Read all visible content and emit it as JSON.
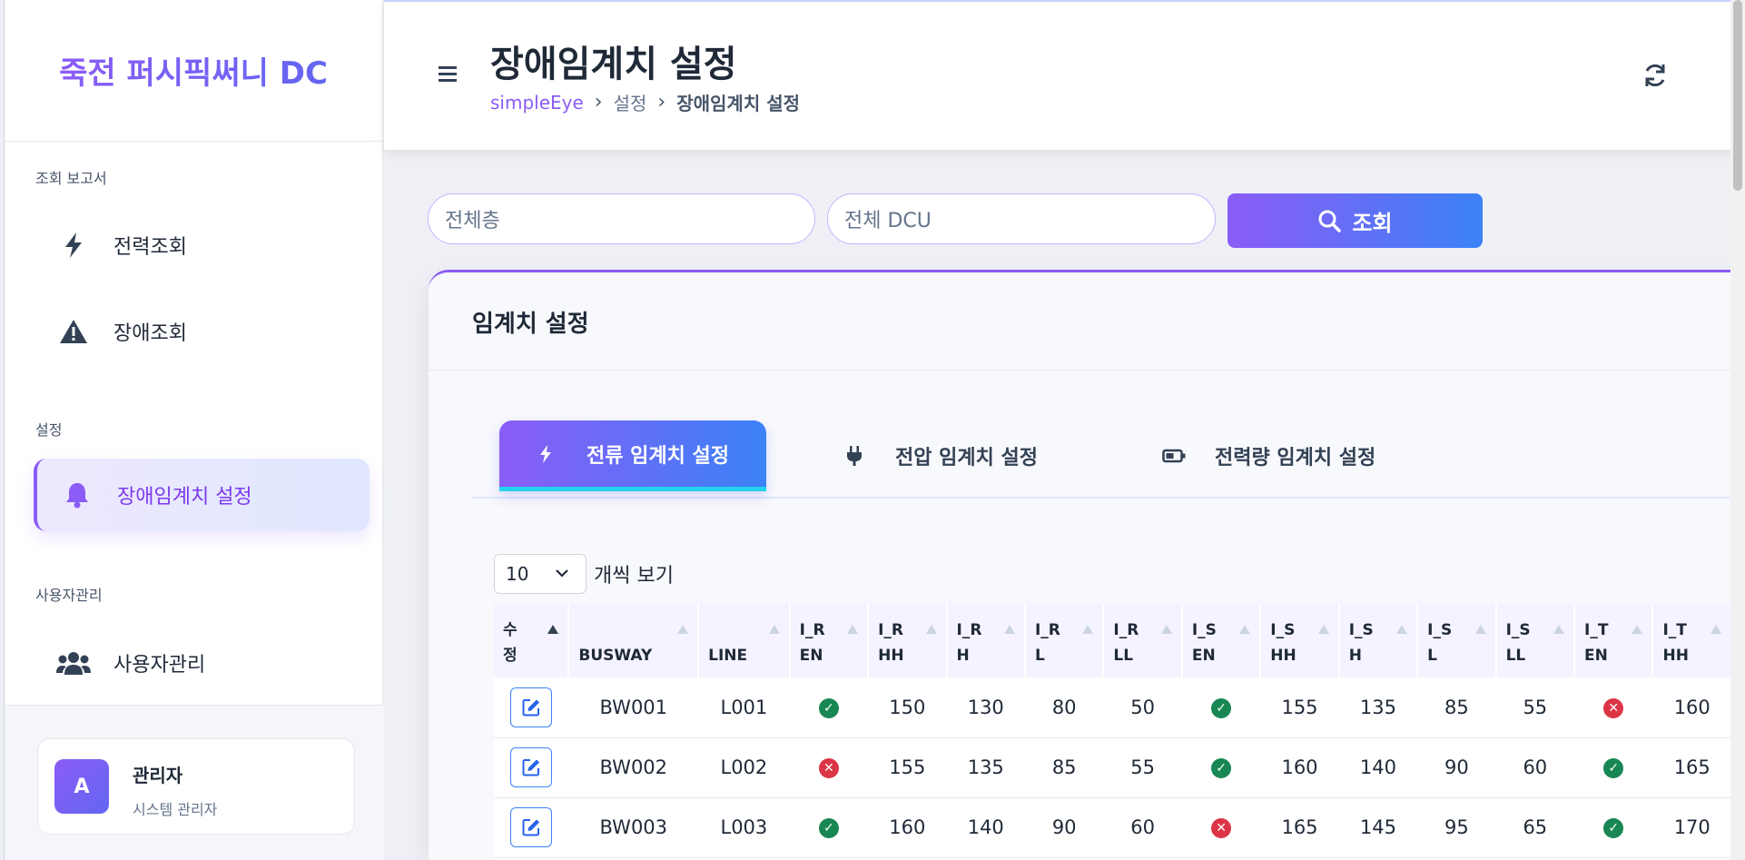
{
  "sidebar": {
    "brand": "죽전 퍼시픽써니 DC",
    "sections": [
      {
        "label": "조회 보고서"
      },
      {
        "label": "설정"
      },
      {
        "label": "사용자관리"
      }
    ],
    "items": [
      {
        "label": "전력조회",
        "icon": "bolt-icon"
      },
      {
        "label": "장애조회",
        "icon": "warning-icon"
      },
      {
        "label": "장애임계치 설정",
        "icon": "bell-icon",
        "active": true
      },
      {
        "label": "사용자관리",
        "icon": "users-icon"
      }
    ],
    "user": {
      "avatar": "A",
      "name": "관리자",
      "role": "시스템 관리자"
    }
  },
  "header": {
    "title": "장애임계치 설정",
    "breadcrumb": [
      "simpleEye",
      "설정",
      "장애임계치 설정"
    ]
  },
  "filters": {
    "floor": "전체층",
    "dcu": "전체 DCU",
    "search_label": "조회"
  },
  "card": {
    "title": "임계치 설정",
    "tabs": [
      {
        "label": "전류 임계치 설정",
        "icon": "bolt-icon",
        "active": true
      },
      {
        "label": "전압 임계치 설정",
        "icon": "plug-icon"
      },
      {
        "label": "전력량 임계치 설정",
        "icon": "battery-icon"
      }
    ],
    "page_length": "10",
    "page_length_label": "개씩 보기",
    "table": {
      "headers": [
        [
          "수",
          "정"
        ],
        [
          "",
          "BUSWAY"
        ],
        [
          "",
          "LINE"
        ],
        [
          "I_R",
          "EN"
        ],
        [
          "I_R",
          "HH"
        ],
        [
          "I_R",
          "H"
        ],
        [
          "I_R",
          "L"
        ],
        [
          "I_R",
          "LL"
        ],
        [
          "I_S",
          "EN"
        ],
        [
          "I_S",
          "HH"
        ],
        [
          "I_S",
          "H"
        ],
        [
          "I_S",
          "L"
        ],
        [
          "I_S",
          "LL"
        ],
        [
          "I_T",
          "EN"
        ],
        [
          "I_T",
          "HH"
        ]
      ],
      "rows": [
        {
          "busway": "BW001",
          "line": "L001",
          "r_en": "ok",
          "r_hh": "150",
          "r_h": "130",
          "r_l": "80",
          "r_ll": "50",
          "s_en": "ok",
          "s_hh": "155",
          "s_h": "135",
          "s_l": "85",
          "s_ll": "55",
          "t_en": "no",
          "t_hh": "160"
        },
        {
          "busway": "BW002",
          "line": "L002",
          "r_en": "no",
          "r_hh": "155",
          "r_h": "135",
          "r_l": "85",
          "r_ll": "55",
          "s_en": "ok",
          "s_hh": "160",
          "s_h": "140",
          "s_l": "90",
          "s_ll": "60",
          "t_en": "ok",
          "t_hh": "165"
        },
        {
          "busway": "BW003",
          "line": "L003",
          "r_en": "ok",
          "r_hh": "160",
          "r_h": "140",
          "r_l": "90",
          "r_ll": "60",
          "s_en": "no",
          "s_hh": "165",
          "s_h": "145",
          "s_l": "95",
          "s_ll": "65",
          "t_en": "ok",
          "t_hh": "170"
        }
      ]
    }
  },
  "colors": {
    "accent": "#8b5cf6",
    "accent2": "#3b82f6",
    "ok": "#198754",
    "error": "#dc3545"
  }
}
